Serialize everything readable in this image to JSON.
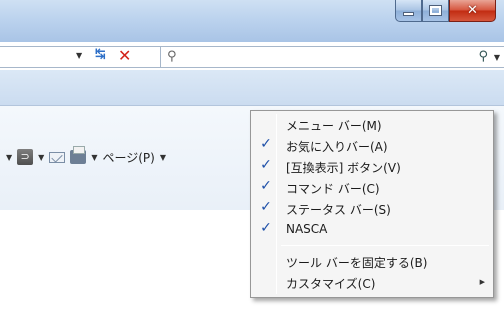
{
  "window": {
    "caption_buttons": {
      "minimize_icon": "minimize-icon",
      "maximize_icon": "maximize-icon",
      "close_glyph": "✕"
    }
  },
  "address_bar": {
    "dropdown_glyph": "▼",
    "refresh_glyph": "↹",
    "stop_glyph": "✕"
  },
  "search": {
    "placeholder": "",
    "left_glyph": "⚲",
    "go_glyph": "⚲",
    "arrow_glyph": "▼"
  },
  "command_bar": {
    "arrow_glyph": "▼",
    "rss_glyph": "⊃",
    "page_label": "ページ(P)"
  },
  "context_menu": {
    "items": [
      {
        "label": "メニュー バー(M)",
        "checked": false,
        "check_glyph": ""
      },
      {
        "label": "お気に入りバー(A)",
        "checked": true,
        "check_glyph": "✓"
      },
      {
        "label": "[互換表示] ボタン(V)",
        "checked": true,
        "check_glyph": "✓"
      },
      {
        "label": "コマンド バー(C)",
        "checked": true,
        "check_glyph": "✓"
      },
      {
        "label": "ステータス バー(S)",
        "checked": true,
        "check_glyph": "✓"
      },
      {
        "label": "NASCA",
        "checked": true,
        "check_glyph": "✓"
      },
      {
        "label": "ツール バーを固定する(B)",
        "checked": false,
        "check_glyph": ""
      },
      {
        "label": "カスタマイズ(C)",
        "checked": false,
        "check_glyph": "",
        "submenu_glyph": "▶"
      }
    ]
  },
  "colors": {
    "check": "#1d4fa8",
    "close_button": "#c22c12",
    "titlebar": "#bcd3ee"
  }
}
